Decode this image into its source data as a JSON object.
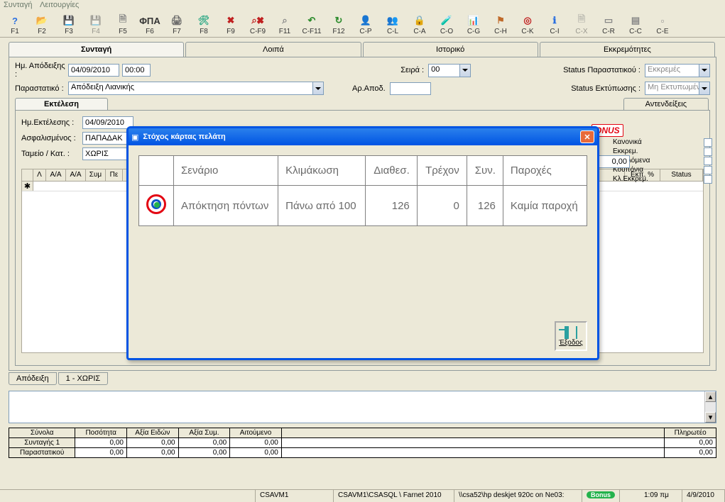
{
  "menu": {
    "syntagi": "Συνταγή",
    "leitourgies": "Λειτουργίες"
  },
  "toolbar": [
    {
      "key": "F1",
      "icon": "help"
    },
    {
      "key": "F2",
      "icon": "open"
    },
    {
      "key": "F3",
      "icon": "save"
    },
    {
      "key": "F4",
      "icon": "save",
      "disabled": true
    },
    {
      "key": "F5",
      "icon": "doc"
    },
    {
      "key": "F6",
      "icon": "fpa",
      "text": "ΦΠΑ"
    },
    {
      "key": "F7",
      "icon": "print"
    },
    {
      "key": "F8",
      "icon": "tools"
    },
    {
      "key": "F9",
      "icon": "delete"
    },
    {
      "key": "C-F9",
      "icon": "find-del"
    },
    {
      "key": "F11",
      "icon": "find"
    },
    {
      "key": "C-F11",
      "icon": "back"
    },
    {
      "key": "F12",
      "icon": "reload"
    },
    {
      "key": "C-P",
      "icon": "person"
    },
    {
      "key": "C-L",
      "icon": "people"
    },
    {
      "key": "C-A",
      "icon": "lock"
    },
    {
      "key": "C-O",
      "icon": "vial"
    },
    {
      "key": "C-G",
      "icon": "chart"
    },
    {
      "key": "C-H",
      "icon": "flag"
    },
    {
      "key": "C-K",
      "icon": "target"
    },
    {
      "key": "C-I",
      "icon": "info"
    },
    {
      "key": "C-X",
      "icon": "doc",
      "disabled": true
    },
    {
      "key": "C-R",
      "icon": "sheet"
    },
    {
      "key": "C-C",
      "icon": "printer"
    },
    {
      "key": "C-E",
      "icon": "page"
    }
  ],
  "maintabs": {
    "syntagi": "Συνταγή",
    "loipa": "Λοιπά",
    "istoriko": "Ιστορικό",
    "ekkrem": "Εκκρεμότητες"
  },
  "header": {
    "dateLbl": "Ημ. Απόδειξης :",
    "date": "04/09/2010",
    "time": "00:00",
    "parastLbl": "Παραστατικό :",
    "parast": "Απόδειξη Λιανικής",
    "seiraLbl": "Σειρά :",
    "seira": "00",
    "arApodLbl": "Αρ.Αποδ.",
    "arApod": "",
    "statusParastLbl": "Status Παραστατικού :",
    "statusParast": "Εκκρεμές",
    "statusEktypLbl": "Status Εκτύπωσης :",
    "statusEktyp": "Μη Εκτυπωμένο"
  },
  "subtabs": {
    "ektelesi": "Εκτέλεση",
    "antendeikseis": "Αντενδείξεις"
  },
  "exec": {
    "dateLbl": "Ημ.Εκτέλεσης :",
    "date": "04/09/2010",
    "asfalLbl": "Ασφαλισμένος :",
    "asfal": "ΠΑΠΑΔΑΚ",
    "tameioLbl": "Ταμείο / Κατ. :",
    "tameio": "ΧΩΡΙΣ"
  },
  "gridHeaders": [
    "Λ",
    "Α/Α",
    "Α/Α",
    "Συμ",
    "Πε",
    "Εκπ. %",
    "Status"
  ],
  "rightCheckboxes": {
    "bonus": "ONUS",
    "amount": "0,00",
    "items": [
      "Κανονικά",
      "Εκκρεμ.",
      "Οφειλόμενα",
      "Κουπόνια",
      "Κλ.Εκκρεμ."
    ]
  },
  "bottomTabs": {
    "apodeiksi": "Απόδειξη",
    "xwris": "1 - ΧΩΡΙΣ"
  },
  "totals": {
    "headers": [
      "Σύνολα",
      "Ποσότητα",
      "Αξία Ειδών",
      "Αξία Συμ.",
      "Αιτούμενο",
      "Πληρωτέο"
    ],
    "rows": [
      {
        "lbl": "Συνταγής 1",
        "qty": "0,00",
        "axia": "0,00",
        "sym": "0,00",
        "ait": "0,00",
        "plir": "0,00"
      },
      {
        "lbl": "Παραστατικού",
        "qty": "0,00",
        "axia": "0,00",
        "sym": "0,00",
        "ait": "0,00",
        "plir": "0,00"
      }
    ]
  },
  "statusbar": {
    "host": "CSAVM1",
    "conn": "CSAVM1\\CSASQL \\ Farnet  2010",
    "printer": "\\\\csa52\\hp deskjet 920c on Ne03:",
    "bonus": "Bonus",
    "time": "1:09 πμ",
    "date": "4/9/2010"
  },
  "modal": {
    "title": "Στόχος κάρτας πελάτη",
    "headers": {
      "senario": "Σενάριο",
      "klimakwsi": "Κλιμάκωση",
      "diathes": "Διαθεσ.",
      "trexon": "Τρέχον",
      "syn": "Συν.",
      "paroxes": "Παροχές"
    },
    "row": {
      "senario": "Απόκτηση πόντων",
      "klimakwsi": "Πάνω από 100",
      "diathes": "126",
      "trexon": "0",
      "syn": "126",
      "paroxes": "Καμία παροχή"
    },
    "exit": "Έξοδος"
  }
}
